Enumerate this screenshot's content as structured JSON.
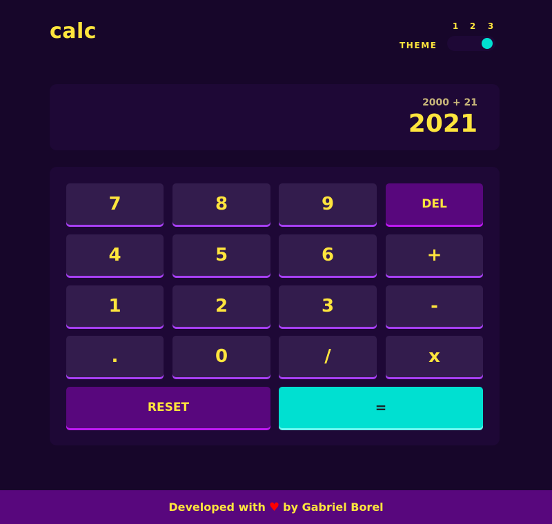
{
  "header": {
    "logo": "calc",
    "theme_label": "THEME",
    "theme_options": [
      "1",
      "2",
      "3"
    ],
    "active_theme": 3
  },
  "display": {
    "previous": "2000 + 21",
    "result": "2021"
  },
  "keys": [
    [
      "7",
      "8",
      "9",
      "DEL"
    ],
    [
      "4",
      "5",
      "6",
      "+"
    ],
    [
      "1",
      "2",
      "3",
      "-"
    ],
    [
      ".",
      "0",
      "/",
      "x"
    ]
  ],
  "actions": {
    "reset_label": "RESET",
    "equals_label": "="
  },
  "footer": {
    "text_before": "Developed with",
    "heart_icon": "heart-icon",
    "text_after": "by Gabriel Borel"
  },
  "colors": {
    "background": "#17062a",
    "panel": "#1e0836",
    "key": "#331c4d",
    "key_shadow": "#a73ff3",
    "accent_purple": "#58077d",
    "accent_cyan": "#00e0d1",
    "text": "#ffe53d"
  }
}
